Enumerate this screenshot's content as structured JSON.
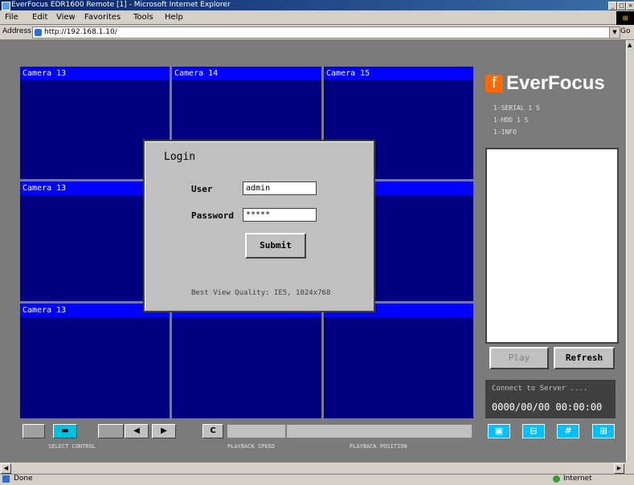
{
  "window": {
    "title": "EverFocus EDR1600 Remote [1] - Microsoft Internet Explorer",
    "buttons": {
      "minimize": "_",
      "maximize": "□",
      "close": "×"
    }
  },
  "menu": [
    "File",
    "Edit",
    "View",
    "Favorites",
    "Tools",
    "Help"
  ],
  "address": {
    "label": "Address",
    "url": "http://192.168.1.10/",
    "go": "Go"
  },
  "cameras": [
    {
      "label": "Camera 13"
    },
    {
      "label": "Camera 14"
    },
    {
      "label": "Camera 15"
    },
    {
      "label": "Camera 13"
    },
    {
      "label": ""
    },
    {
      "label": ""
    },
    {
      "label": "Camera 13"
    },
    {
      "label": ""
    },
    {
      "label": ""
    }
  ],
  "login": {
    "title": "Login",
    "user_label": "User",
    "user_value": "admin",
    "password_label": "Password",
    "password_value": "*****",
    "submit": "Submit",
    "footer": "Best View Quality: IE5, 1024x768"
  },
  "right_panel": {
    "brand": "EverFocus",
    "info_lines": [
      "1-SERIAL 1 S",
      "1-HDD 1 S",
      "1-INFO"
    ],
    "play": "Play",
    "refresh": "Refresh",
    "connect_status": "Connect to Server ....",
    "datetime": "0000/00/00 00:00:00"
  },
  "controls": {
    "buttons": [
      "▬",
      "◀",
      "▶",
      "C"
    ],
    "labels": [
      "SELECT CONTROL",
      "PLAYBACK SPEED",
      "PLAYBACK POSITION"
    ]
  },
  "layout_buttons": [
    "▣",
    "⊟",
    "#",
    "⊞"
  ],
  "status": {
    "left": "Done",
    "zone": "Internet"
  }
}
